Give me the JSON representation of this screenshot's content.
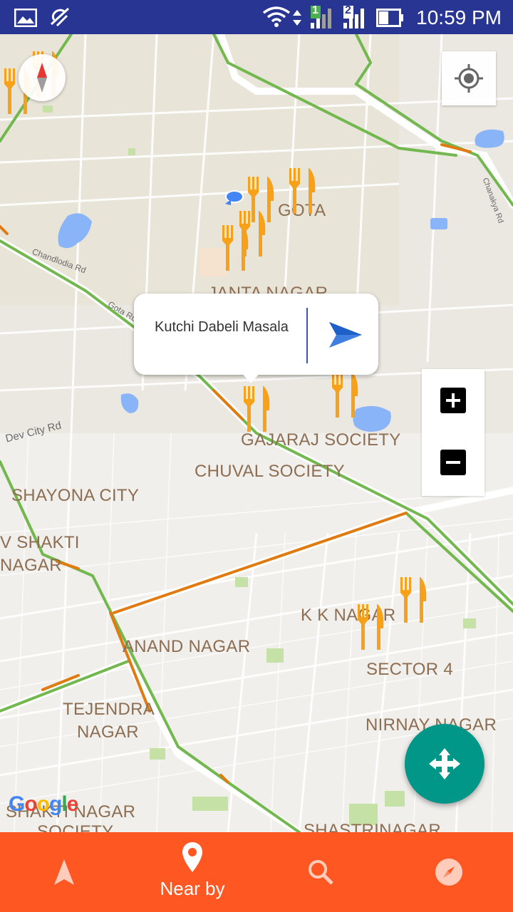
{
  "status_bar": {
    "time": "10:59 PM",
    "sim1_label": "1",
    "sim2_label": "2"
  },
  "map": {
    "places": [
      {
        "name": "GOTA"
      },
      {
        "name": "JANTA NAGAR"
      },
      {
        "name": "GAJARAJ SOCIETY"
      },
      {
        "name": "CHUVAL SOCIETY"
      },
      {
        "name": "SHAYONA CITY"
      },
      {
        "name": "V SHAKTI"
      },
      {
        "name": "NAGAR"
      },
      {
        "name": "K K NAGAR"
      },
      {
        "name": "ANAND NAGAR"
      },
      {
        "name": "SECTOR 4"
      },
      {
        "name": "TEJENDRA"
      },
      {
        "name": "NAGAR"
      },
      {
        "name": "NIRNAY NAGAR"
      },
      {
        "name": "SHASTRINAGAR"
      },
      {
        "name": "SHAKTI NAGAR"
      },
      {
        "name": "SOCIETY"
      }
    ],
    "roads": [
      {
        "name": "Dev City Rd"
      },
      {
        "name": "Chandlodia Rd"
      },
      {
        "name": "Gota Rd"
      },
      {
        "name": "Chanakya Rd"
      }
    ],
    "attribution": "Google",
    "info_window": {
      "title": "Kutchi Dabeli Masala"
    },
    "colors": {
      "pin": "#f7a11a",
      "road_major": "#72b84e",
      "road_traffic": "#e07b12",
      "water": "#8ab4f8"
    }
  },
  "bottom_nav": {
    "items": [
      {
        "label": "",
        "icon": "navigation-arrow-icon"
      },
      {
        "label": "Near by",
        "icon": "location-pin-icon"
      },
      {
        "label": "",
        "icon": "search-icon"
      },
      {
        "label": "",
        "icon": "compass-icon"
      }
    ],
    "color": "#ff5722"
  }
}
